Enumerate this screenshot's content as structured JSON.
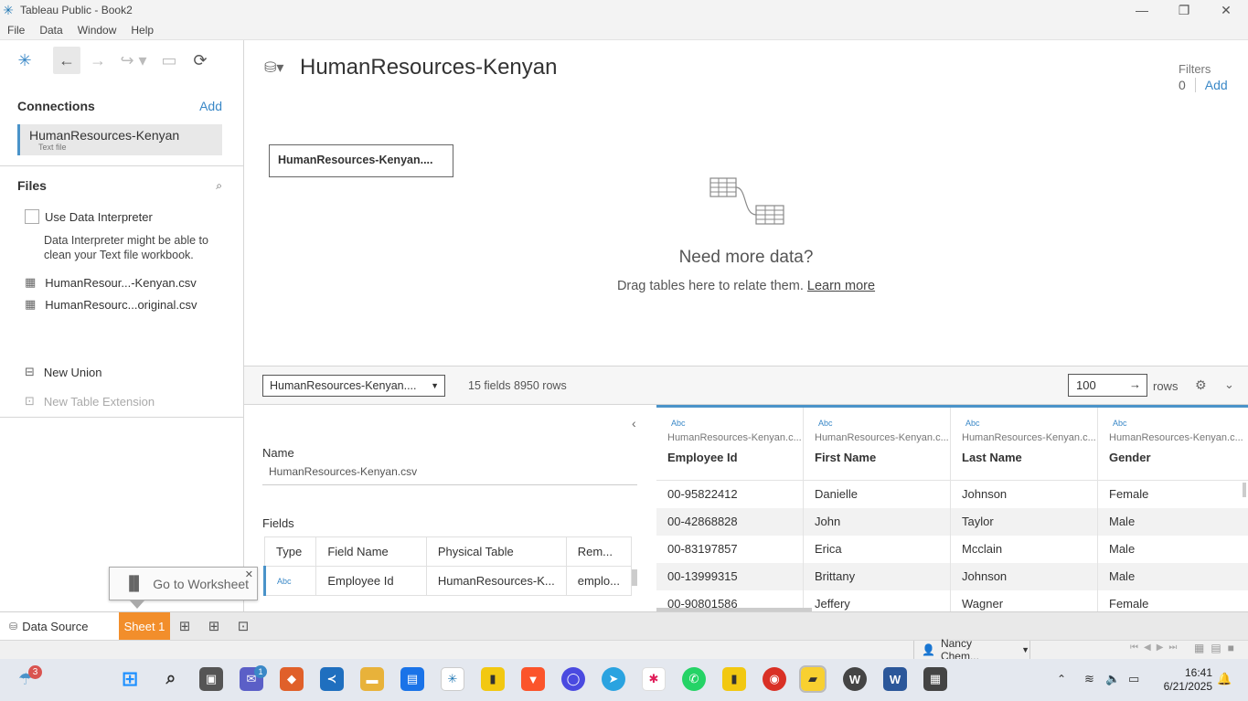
{
  "window": {
    "title": "Tableau Public - Book2"
  },
  "menu": [
    "File",
    "Data",
    "Window",
    "Help"
  ],
  "datasource": {
    "title": "HumanResources-Kenyan",
    "filters_label": "Filters",
    "filters_count": "0",
    "filters_add": "Add"
  },
  "connections": {
    "title": "Connections",
    "add": "Add",
    "item_name": "HumanResources-Kenyan",
    "item_type": "Text file"
  },
  "files": {
    "title": "Files",
    "interpreter_label": "Use Data Interpreter",
    "interpreter_hint": "Data Interpreter might be able to clean your Text file workbook.",
    "items": [
      "HumanResour...-Kenyan.csv",
      "HumanResourc...original.csv"
    ],
    "new_union": "New Union",
    "new_table_ext": "New Table Extension"
  },
  "canvas": {
    "table_chip": "HumanResources-Kenyan....",
    "need_more": "Need more data?",
    "drag_hint": "Drag tables here to relate them.",
    "learn_more": "Learn more"
  },
  "bottom_bar": {
    "table_select": "HumanResources-Kenyan....",
    "summary": "15 fields 8950 rows",
    "rows_value": "100",
    "rows_label": "rows"
  },
  "meta": {
    "name_label": "Name",
    "name_value": "HumanResources-Kenyan.csv",
    "fields_label": "Fields",
    "headers": [
      "Type",
      "Field Name",
      "Physical Table",
      "Rem..."
    ],
    "row": {
      "type": "Abc",
      "field": "Employee Id",
      "table": "HumanResources-K...",
      "remote": "emplo..."
    }
  },
  "grid": {
    "columns": [
      {
        "type": "Abc",
        "source": "HumanResources-Kenyan.c...",
        "name": "Employee Id"
      },
      {
        "type": "Abc",
        "source": "HumanResources-Kenyan.c...",
        "name": "First Name"
      },
      {
        "type": "Abc",
        "source": "HumanResources-Kenyan.c...",
        "name": "Last Name"
      },
      {
        "type": "Abc",
        "source": "HumanResources-Kenyan.c...",
        "name": "Gender"
      }
    ],
    "rows": [
      [
        "00-95822412",
        "Danielle",
        "Johnson",
        "Female"
      ],
      [
        "00-42868828",
        "John",
        "Taylor",
        "Male"
      ],
      [
        "00-83197857",
        "Erica",
        "Mcclain",
        "Male"
      ],
      [
        "00-13999315",
        "Brittany",
        "Johnson",
        "Male"
      ],
      [
        "00-90801586",
        "Jeffery",
        "Wagner",
        "Female"
      ]
    ]
  },
  "tabs": {
    "data_source": "Data Source",
    "sheet1": "Sheet 1",
    "tooltip": "Go to Worksheet"
  },
  "status": {
    "user": "Nancy Chem..."
  },
  "taskbar": {
    "time": "16:41",
    "date": "6/21/2025",
    "badge_left": "3",
    "badge_chat": "1"
  },
  "colors": {
    "accent": "#3a88c7",
    "sheet_tab": "#f28e2b"
  }
}
